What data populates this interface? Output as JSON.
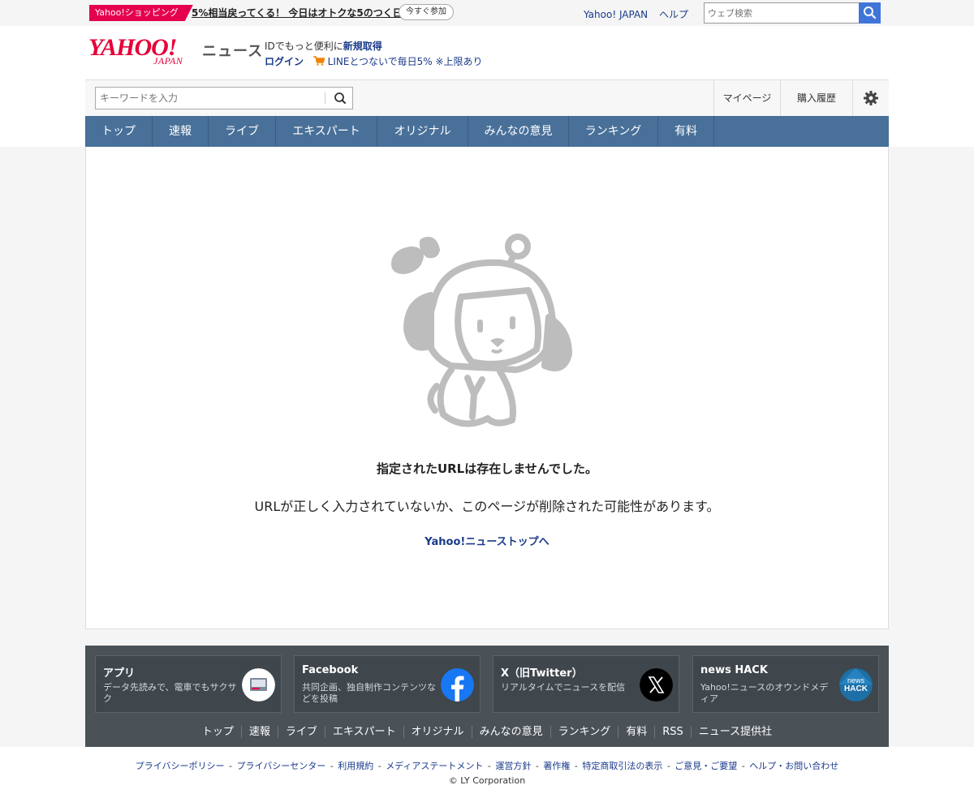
{
  "topbar": {
    "shop_badge": "Yahoo!ショッピング",
    "shop_promo": "5%相当戻ってくる！ 今日はオトクな5のつく日",
    "shop_join": "今すぐ参加",
    "links": [
      "Yahoo! JAPAN",
      "ヘルプ"
    ],
    "web_search_placeholder": "ウェブ検索"
  },
  "header": {
    "logo_yahoo": "YAHOO!",
    "logo_japan": "JAPAN",
    "logo_news": "ニュース",
    "id_text": "IDでもっと便利に",
    "id_register": "新規取得",
    "login": "ログイン",
    "line_promo": "LINEとつないで毎日5% ※上限あり"
  },
  "search": {
    "placeholder": "キーワードを入力",
    "mypage": "マイページ",
    "history": "購入履歴"
  },
  "gnav": [
    "トップ",
    "速報",
    "ライブ",
    "エキスパート",
    "オリジナル",
    "みんなの意見",
    "ランキング",
    "有料"
  ],
  "error": {
    "title": "指定されたURLは存在しませんでした。",
    "description": "URLが正しく入力されていないか、このページが削除された可能性があります。",
    "link": "Yahoo!ニューストップへ"
  },
  "footer": {
    "cards": [
      {
        "title": "アプリ",
        "desc": "データ先読みで、電車でもサクサク",
        "icon": "app-icon"
      },
      {
        "title": "Facebook",
        "desc": "共同企画、独自制作コンテンツなどを投稿",
        "icon": "facebook-icon"
      },
      {
        "title": "X（旧Twitter）",
        "desc": "リアルタイムでニュースを配信",
        "icon": "x-icon"
      },
      {
        "title": "news HACK",
        "desc": "Yahoo!ニュースのオウンドメディア",
        "icon": "newshack-icon",
        "icon_text_1": "news",
        "icon_text_2": "HACK"
      }
    ],
    "nav": [
      "トップ",
      "速報",
      "ライブ",
      "エキスパート",
      "オリジナル",
      "みんなの意見",
      "ランキング",
      "有料",
      "RSS",
      "ニュース提供社"
    ]
  },
  "bottom": {
    "legal_links": [
      "プライバシーポリシー",
      "プライバシーセンター",
      "利用規約",
      "メディアステートメント",
      "運営方針",
      "著作権",
      "特定商取引法の表示",
      "ご意見・ご要望",
      "ヘルプ・お問い合わせ"
    ],
    "copyright": "© LY Corporation"
  },
  "colors": {
    "brand_red": "#e50037",
    "link_blue": "#1a3a8a",
    "nav_blue": "#487099",
    "footer_gray": "#4a5258"
  }
}
